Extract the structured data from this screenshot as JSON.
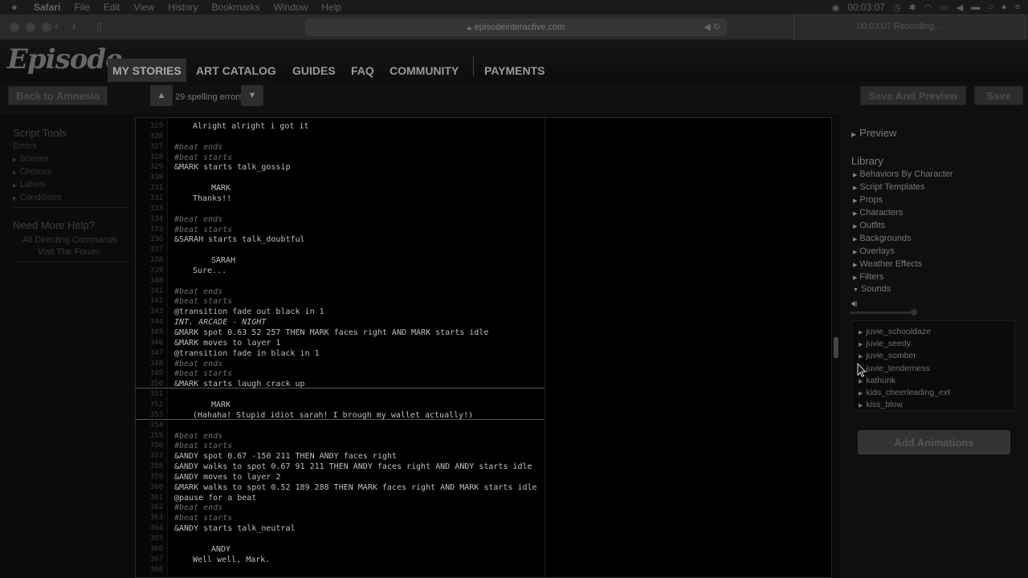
{
  "menubar": {
    "apple": "",
    "items": [
      "Safari",
      "File",
      "Edit",
      "View",
      "History",
      "Bookmarks",
      "Window",
      "Help"
    ],
    "time": "00:03:07"
  },
  "browser": {
    "url": "episodeinteractive.com"
  },
  "recorder": {
    "title": "00:03:07 Recording..."
  },
  "site": {
    "logo": "Episode",
    "nav": [
      "MY STORIES",
      "ART CATALOG",
      "GUIDES",
      "FAQ",
      "COMMUNITY",
      "PAYMENTS"
    ]
  },
  "toolbar": {
    "back_label": "Back to Amnesia",
    "spelling": "29 spelling errors",
    "save_preview_label": "Save And Preview",
    "save_label": "Save"
  },
  "sidebar": {
    "tools_title": "Script Tools",
    "errors": "Errors",
    "items": [
      "Scenes",
      "Choices",
      "Labels",
      "Conditions"
    ],
    "help_title": "Need More Help?",
    "links": [
      "All Directing Commands",
      "Visit The Forum"
    ]
  },
  "editor": {
    "lines": [
      {
        "n": "325",
        "t": "Alright alright i got it",
        "k": "i1"
      },
      {
        "n": "326",
        "t": "",
        "k": ""
      },
      {
        "n": "327",
        "t": "#beat ends",
        "k": "cmt"
      },
      {
        "n": "328",
        "t": "#beat starts",
        "k": "cmt"
      },
      {
        "n": "329",
        "t": "&MARK starts talk_gossip",
        "k": ""
      },
      {
        "n": "330",
        "t": "",
        "k": ""
      },
      {
        "n": "331",
        "t": "MARK",
        "k": "i2"
      },
      {
        "n": "332",
        "t": "Thanks!!",
        "k": "i1"
      },
      {
        "n": "333",
        "t": "",
        "k": ""
      },
      {
        "n": "334",
        "t": "#beat ends",
        "k": "cmt"
      },
      {
        "n": "335",
        "t": "#beat starts",
        "k": "cmt"
      },
      {
        "n": "336",
        "t": "&SARAH starts talk_doubtful",
        "k": ""
      },
      {
        "n": "337",
        "t": "",
        "k": ""
      },
      {
        "n": "338",
        "t": "SARAH",
        "k": "i2"
      },
      {
        "n": "339",
        "t": "Sure...",
        "k": "i1"
      },
      {
        "n": "340",
        "t": "",
        "k": ""
      },
      {
        "n": "341",
        "t": "#beat ends",
        "k": "cmt"
      },
      {
        "n": "342",
        "t": "#beat starts",
        "k": "cmt"
      },
      {
        "n": "343",
        "t": "@transition fade out black in 1",
        "k": ""
      },
      {
        "n": "344",
        "t": "INT. ARCADE - NIGHT",
        "k": "loc"
      },
      {
        "n": "345",
        "t": "&MARK spot 0.63 52 257 THEN MARK faces right AND MARK starts idle",
        "k": ""
      },
      {
        "n": "346",
        "t": "&MARK moves to layer 1",
        "k": ""
      },
      {
        "n": "347",
        "t": "@transition fade in black in 1",
        "k": ""
      },
      {
        "n": "348",
        "t": "#beat ends",
        "k": "cmt"
      },
      {
        "n": "349",
        "t": "#beat starts",
        "k": "cmt"
      },
      {
        "n": "350",
        "t": "&MARK starts laugh_crack_up",
        "k": ""
      },
      {
        "n": "351",
        "t": "",
        "k": ""
      },
      {
        "n": "352",
        "t": "MARK",
        "k": "i2"
      },
      {
        "n": "353",
        "t": "(Hahaha! Stupid idiot sarah! I brough my wallet actually!)",
        "k": "i1"
      },
      {
        "n": "354",
        "t": "",
        "k": ""
      },
      {
        "n": "355",
        "t": "#beat ends",
        "k": "cmt"
      },
      {
        "n": "356",
        "t": "#beat starts",
        "k": "cmt"
      },
      {
        "n": "357",
        "t": "&ANDY spot 0.67 -150 211 THEN ANDY faces right",
        "k": ""
      },
      {
        "n": "358",
        "t": "&ANDY walks to spot 0.67 91 211 THEN ANDY faces right AND ANDY starts idle",
        "k": ""
      },
      {
        "n": "359",
        "t": "&ANDY moves to layer 2",
        "k": ""
      },
      {
        "n": "360",
        "t": "&MARK walks to spot 0.52 189 288 THEN MARK faces right AND MARK starts idle",
        "k": ""
      },
      {
        "n": "361",
        "t": "@pause for a beat",
        "k": ""
      },
      {
        "n": "362",
        "t": "#beat ends",
        "k": "cmt"
      },
      {
        "n": "363",
        "t": "#beat starts",
        "k": "cmt"
      },
      {
        "n": "364",
        "t": "&ANDY starts talk_neutral",
        "k": ""
      },
      {
        "n": "365",
        "t": "",
        "k": ""
      },
      {
        "n": "366",
        "t": "ANDY",
        "k": "i2"
      },
      {
        "n": "367",
        "t": "Well well, Mark.",
        "k": "i1"
      },
      {
        "n": "368",
        "t": "",
        "k": ""
      }
    ]
  },
  "right_panel": {
    "preview": "Preview",
    "library": "Library",
    "library_items": [
      "Behaviors By Character",
      "Script Templates",
      "Props",
      "Characters",
      "Outfits",
      "Backgrounds",
      "Overlays",
      "Weather Effects",
      "Filters"
    ],
    "sounds": "Sounds",
    "sound_items": [
      "juvie_schooldaze",
      "juvie_seedy",
      "juvie_somber",
      "juvie_tenderness",
      "kathunk",
      "kids_cheerleading_ext",
      "kiss_blow"
    ],
    "add_animations": "Add Animations"
  }
}
